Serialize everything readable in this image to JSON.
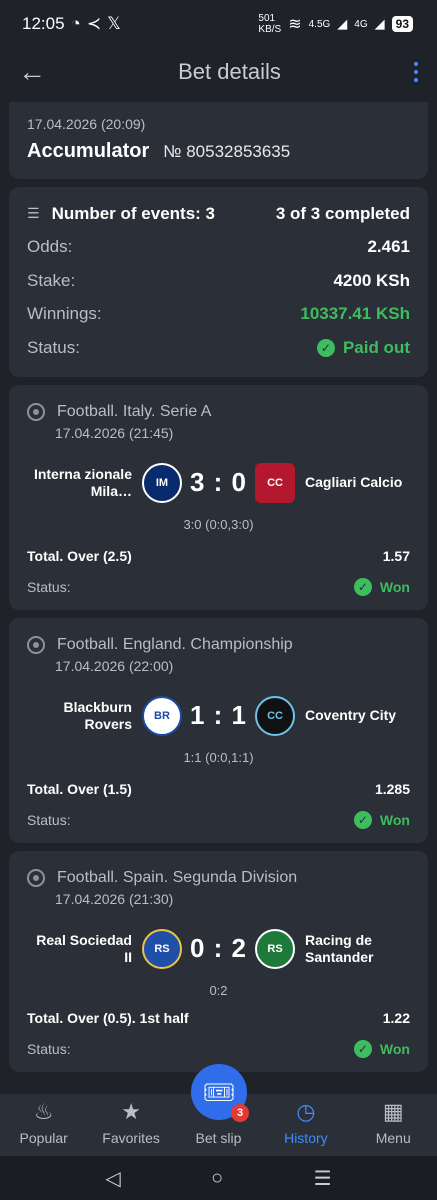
{
  "status_bar": {
    "time": "12:05",
    "speed_value": "501",
    "speed_unit": "KB/S",
    "net1": "4.5G",
    "net2": "4G",
    "battery": "93"
  },
  "header": {
    "title": "Bet details"
  },
  "bet": {
    "date": "17.04.2026 (20:09)",
    "type": "Accumulator",
    "number": "№ 80532853635"
  },
  "summary": {
    "events_label": "Number of events: 3",
    "events_value": "3 of 3 completed",
    "odds_label": "Odds:",
    "odds_value": "2.461",
    "stake_label": "Stake:",
    "stake_value": "4200 KSh",
    "winnings_label": "Winnings:",
    "winnings_value": "10337.41 KSh",
    "status_label": "Status:",
    "status_value": "Paid out"
  },
  "events": [
    {
      "league": "Football. Italy. Serie A",
      "date": "17.04.2026 (21:45)",
      "home": "Interna zionale Mila…",
      "away": "Cagliari Calcio",
      "score": "3 : 0",
      "detail": "3:0 (0:0,3:0)",
      "market": "Total. Over (2.5)",
      "odds": "1.57",
      "status_label": "Status:",
      "result": "Won"
    },
    {
      "league": "Football. England. Championship",
      "date": "17.04.2026 (22:00)",
      "home": "Blackburn Rovers",
      "away": "Coventry City",
      "score": "1 : 1",
      "detail": "1:1 (0:0,1:1)",
      "market": "Total. Over (1.5)",
      "odds": "1.285",
      "status_label": "Status:",
      "result": "Won"
    },
    {
      "league": "Football. Spain. Segunda Division",
      "date": "17.04.2026 (21:30)",
      "home": "Real Sociedad II",
      "away": "Racing de Santander",
      "score": "0 : 2",
      "detail": "0:2",
      "market": "Total. Over (0.5). 1st half",
      "odds": "1.22",
      "status_label": "Status:",
      "result": "Won"
    }
  ],
  "tabs": {
    "popular": "Popular",
    "favorites": "Favorites",
    "betslip": "Bet slip",
    "betslip_count": "3",
    "history": "History",
    "menu": "Menu"
  },
  "colors": {
    "accent": "#3f8cff",
    "win": "#3ebd5e",
    "card": "#2b2f37",
    "bg": "#1f2228"
  }
}
